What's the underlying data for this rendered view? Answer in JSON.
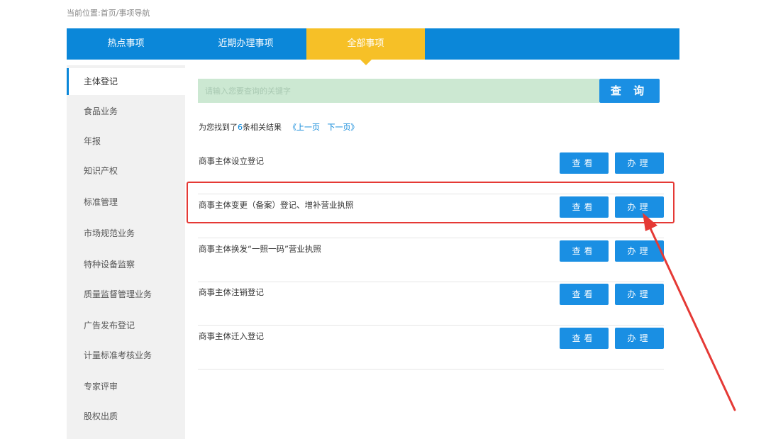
{
  "breadcrumb": "当前位置:首页/事项导航",
  "tabs": [
    {
      "label": "热点事项"
    },
    {
      "label": "近期办理事项"
    },
    {
      "label": "全部事项"
    }
  ],
  "sidebar": {
    "items": [
      {
        "label": "主体登记"
      },
      {
        "label": "食品业务"
      },
      {
        "label": "年报"
      },
      {
        "label": "知识产权"
      },
      {
        "label": "标准管理"
      },
      {
        "label": "市场规范业务"
      },
      {
        "label": "特种设备监察"
      },
      {
        "label": "质量监督管理业务"
      },
      {
        "label": "广告发布登记"
      },
      {
        "label": "计量标准考核业务"
      },
      {
        "label": "专家评审"
      },
      {
        "label": "股权出质"
      }
    ]
  },
  "search": {
    "placeholder": "请输入您要查询的关键字",
    "button_label": "查 询"
  },
  "results": {
    "prefix": "为您找到了",
    "count": "6",
    "suffix": "条相关结果",
    "prev": "《上一页",
    "next": "下一页》"
  },
  "items": [
    {
      "title": "商事主体设立登记",
      "view": "查看",
      "do": "办理"
    },
    {
      "title": "商事主体变更（备案）登记、增补营业执照",
      "view": "查看",
      "do": "办理"
    },
    {
      "title": "商事主体换发“一照一码”营业执照",
      "view": "查看",
      "do": "办理"
    },
    {
      "title": "商事主体注销登记",
      "view": "查看",
      "do": "办理"
    },
    {
      "title": "商事主体迁入登记",
      "view": "查看",
      "do": "办理"
    }
  ],
  "colors": {
    "primary": "#0b87d9",
    "tab_active": "#f6c027",
    "button": "#1a8fe3",
    "search_bg": "#cce8d2",
    "highlight": "#e53935"
  }
}
